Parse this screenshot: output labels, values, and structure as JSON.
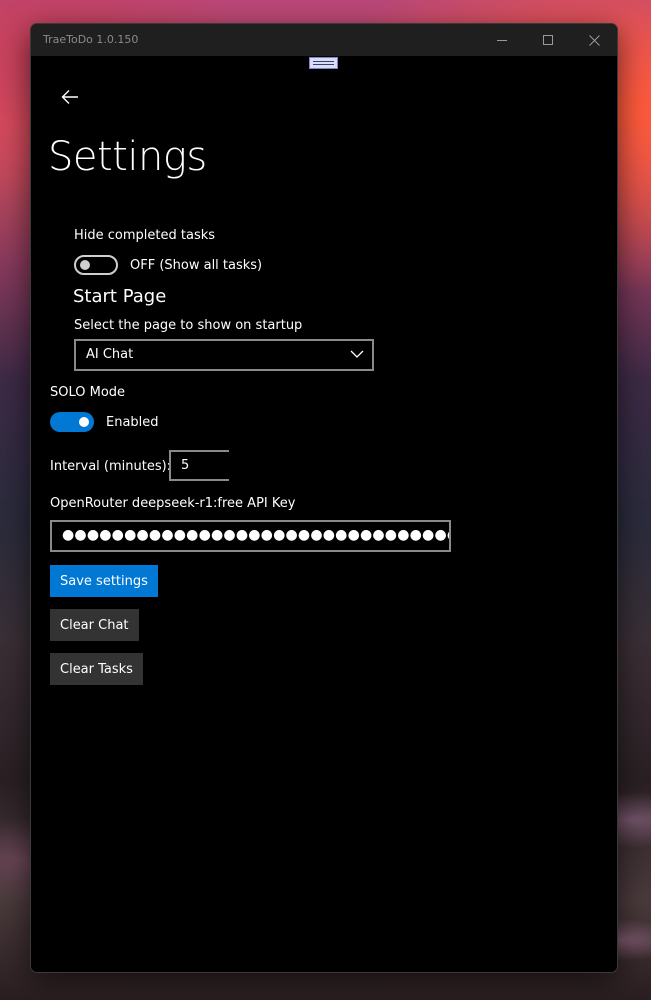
{
  "window": {
    "title": "TraeToDo 1.0.150",
    "controls": {
      "minimize": "minimize-icon",
      "maximize": "maximize-icon",
      "close": "close-icon"
    }
  },
  "page": {
    "back_icon": "back-arrow-icon",
    "title": "Settings"
  },
  "settings": {
    "hide_completed": {
      "label": "Hide completed tasks",
      "state": "OFF (Show all tasks)",
      "on": false
    },
    "start_page": {
      "heading": "Start Page",
      "label": "Select the page to show on startup",
      "selected": "AI Chat"
    },
    "solo_mode": {
      "label": "SOLO Mode",
      "state": "Enabled",
      "on": true
    },
    "interval": {
      "label": "Interval (minutes):",
      "value": "5"
    },
    "api_key": {
      "label": "OpenRouter deepseek-r1:free API Key",
      "masked_value": "●●●●●●●●●●●●●●●●●●●●●●●●●●●●●●●●●●●●●●●●●●●"
    }
  },
  "buttons": {
    "save": "Save settings",
    "clear_chat": "Clear Chat",
    "clear_tasks": "Clear Tasks"
  },
  "colors": {
    "accent": "#0078d4",
    "background": "#000000",
    "secondary_button": "#333333"
  }
}
